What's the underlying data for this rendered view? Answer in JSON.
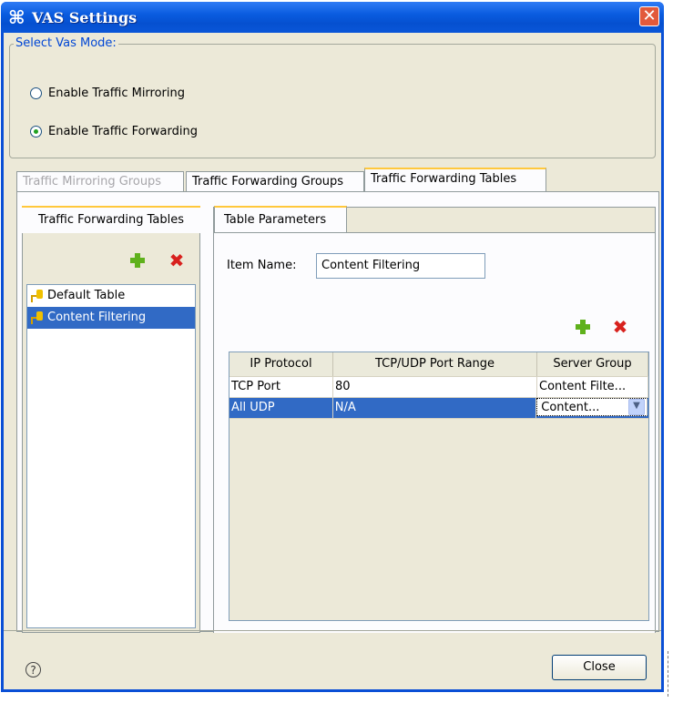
{
  "window": {
    "title": "VAS Settings",
    "title_icon": "app-logo-icon",
    "close_icon": "close-icon"
  },
  "mode_group": {
    "legend": "Select Vas Mode:",
    "options": [
      {
        "label": "Enable Traffic Mirroring",
        "checked": false
      },
      {
        "label": "Enable Traffic Forwarding",
        "checked": true
      }
    ]
  },
  "tabs": [
    {
      "label": "Traffic Mirroring Groups",
      "state": "disabled"
    },
    {
      "label": "Traffic Forwarding Groups",
      "state": "normal"
    },
    {
      "label": "Traffic Forwarding Tables",
      "state": "active"
    }
  ],
  "left_panel": {
    "tab": "Traffic Forwarding Tables",
    "items": [
      {
        "label": "Default Table",
        "selected": false
      },
      {
        "label": "Content Filtering",
        "selected": true
      }
    ]
  },
  "right_panel": {
    "tab": "Table Parameters",
    "item_name_label": "Item Name:",
    "item_name_value": "Content Filtering",
    "grid": {
      "headers": [
        "IP Protocol",
        "TCP/UDP Port Range",
        "Server Group"
      ],
      "rows": [
        {
          "protocol": "TCP Port",
          "port_range": "80",
          "server_group": "Content Filte...",
          "selected": false
        },
        {
          "protocol": "All UDP",
          "port_range": "N/A",
          "server_group": "Content...",
          "selected": true
        }
      ]
    }
  },
  "footer": {
    "help_icon": "help-icon",
    "close_label": "Close"
  },
  "colors": {
    "title_bar": "#0a5ce0",
    "selection": "#316ac5",
    "tab_highlight": "#ffc83c",
    "add": "#5fb11c",
    "delete": "#d8211e"
  }
}
